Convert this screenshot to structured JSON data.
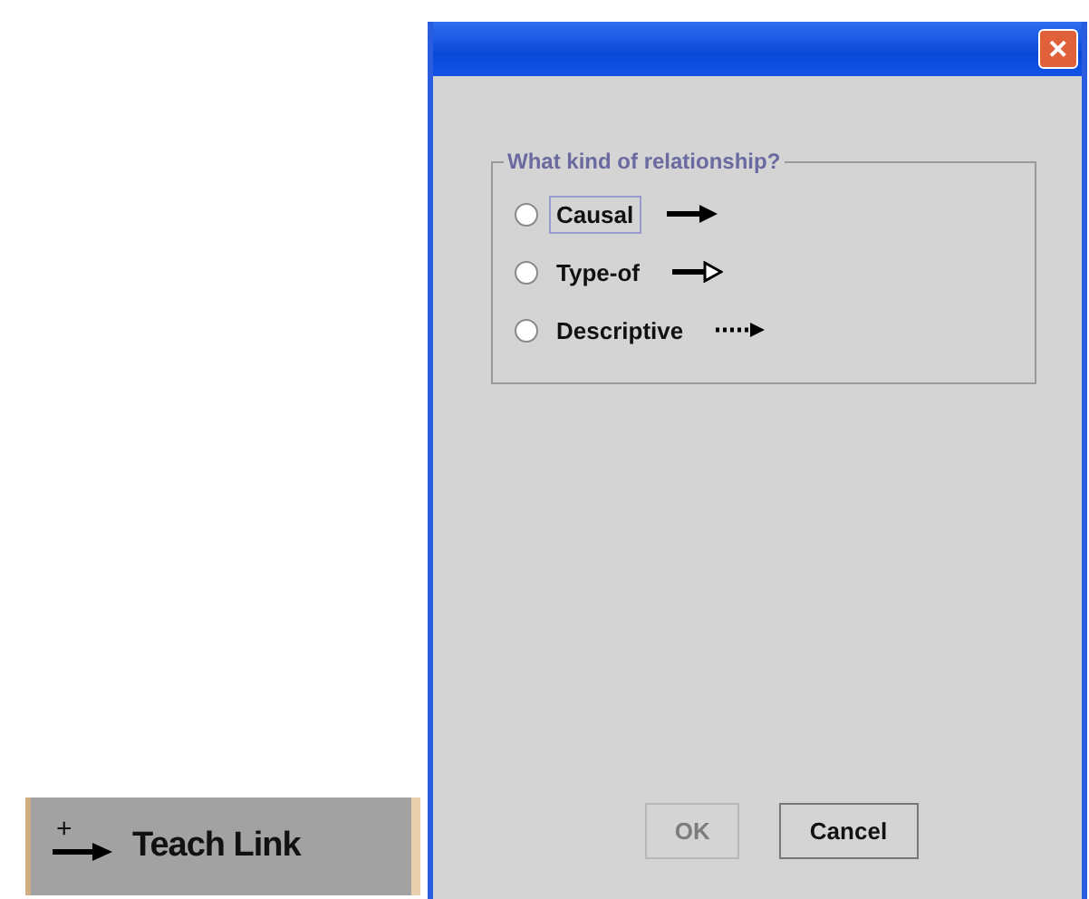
{
  "dialog": {
    "close_button": "✕",
    "group": {
      "legend": "What kind of relationship?",
      "options": [
        {
          "label": "Causal",
          "kind": "solid",
          "selected": false,
          "focused": true
        },
        {
          "label": "Type-of",
          "kind": "open",
          "selected": false,
          "focused": false
        },
        {
          "label": "Descriptive",
          "kind": "dotted",
          "selected": false,
          "focused": false
        }
      ]
    },
    "buttons": [
      {
        "label": "OK",
        "disabled": true
      },
      {
        "label": "Cancel",
        "disabled": false
      }
    ]
  },
  "teach_link": {
    "label": "Teach Link",
    "icon_text": "+"
  }
}
